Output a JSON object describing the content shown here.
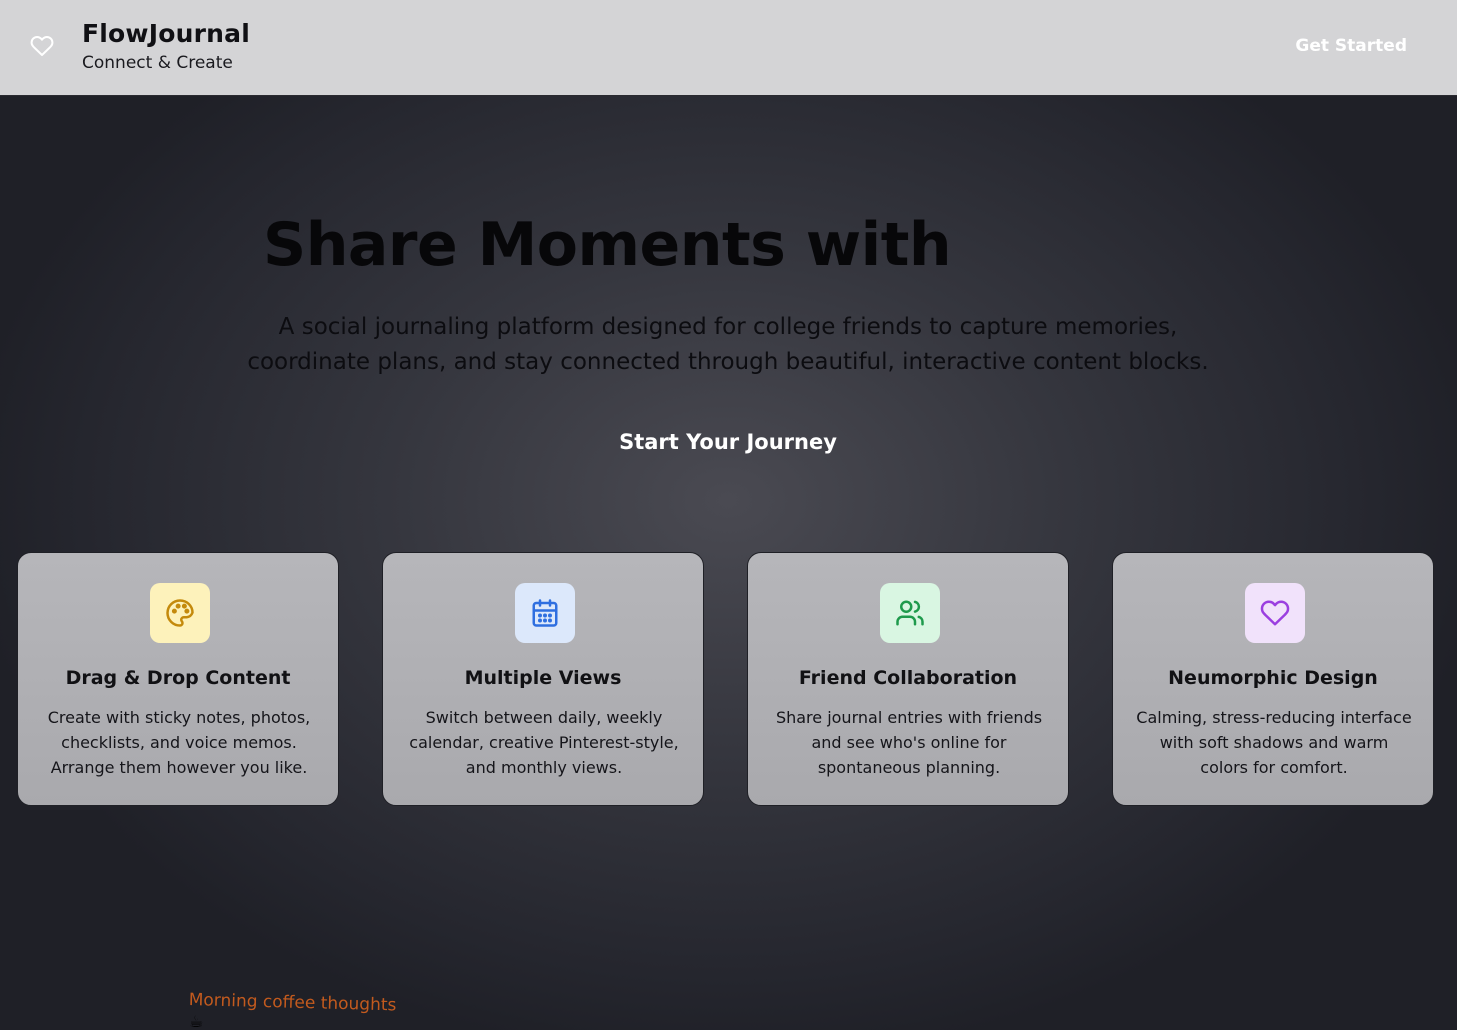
{
  "header": {
    "logo_icon": "heart-outline-icon",
    "title": "FlowJournal",
    "subtitle": "Connect & Create",
    "cta_label": "Get Started"
  },
  "hero": {
    "title": "Share Moments with",
    "description": "A social journaling platform designed for college friends to capture memories, coordinate plans, and stay connected through beautiful, interactive content blocks.",
    "cta_label": "Start Your Journey"
  },
  "features": [
    {
      "icon": "palette-icon",
      "icon_color": "#c48a0c",
      "icon_bg": "#fdf2bb",
      "title": "Drag & Drop Content",
      "description": "Create with sticky notes, photos, checklists, and voice memos. Arrange them however you like."
    },
    {
      "icon": "calendar-icon",
      "icon_color": "#2f6fe0",
      "icon_bg": "#dce8fb",
      "title": "Multiple Views",
      "description": "Switch between daily, weekly calendar, creative Pinterest-style, and monthly views."
    },
    {
      "icon": "users-icon",
      "icon_color": "#1e9a4c",
      "icon_bg": "#d9f6e2",
      "title": "Friend Collaboration",
      "description": "Share journal entries with friends and see who's online for spontaneous planning."
    },
    {
      "icon": "heart-icon",
      "icon_color": "#9b3fe0",
      "icon_bg": "#f1e2fb",
      "title": "Neumorphic Design",
      "description": "Calming, stress-reducing interface with soft shadows and warm colors for comfort."
    }
  ],
  "preview_note": {
    "text": "Morning coffee thoughts",
    "emoji": "☕"
  }
}
